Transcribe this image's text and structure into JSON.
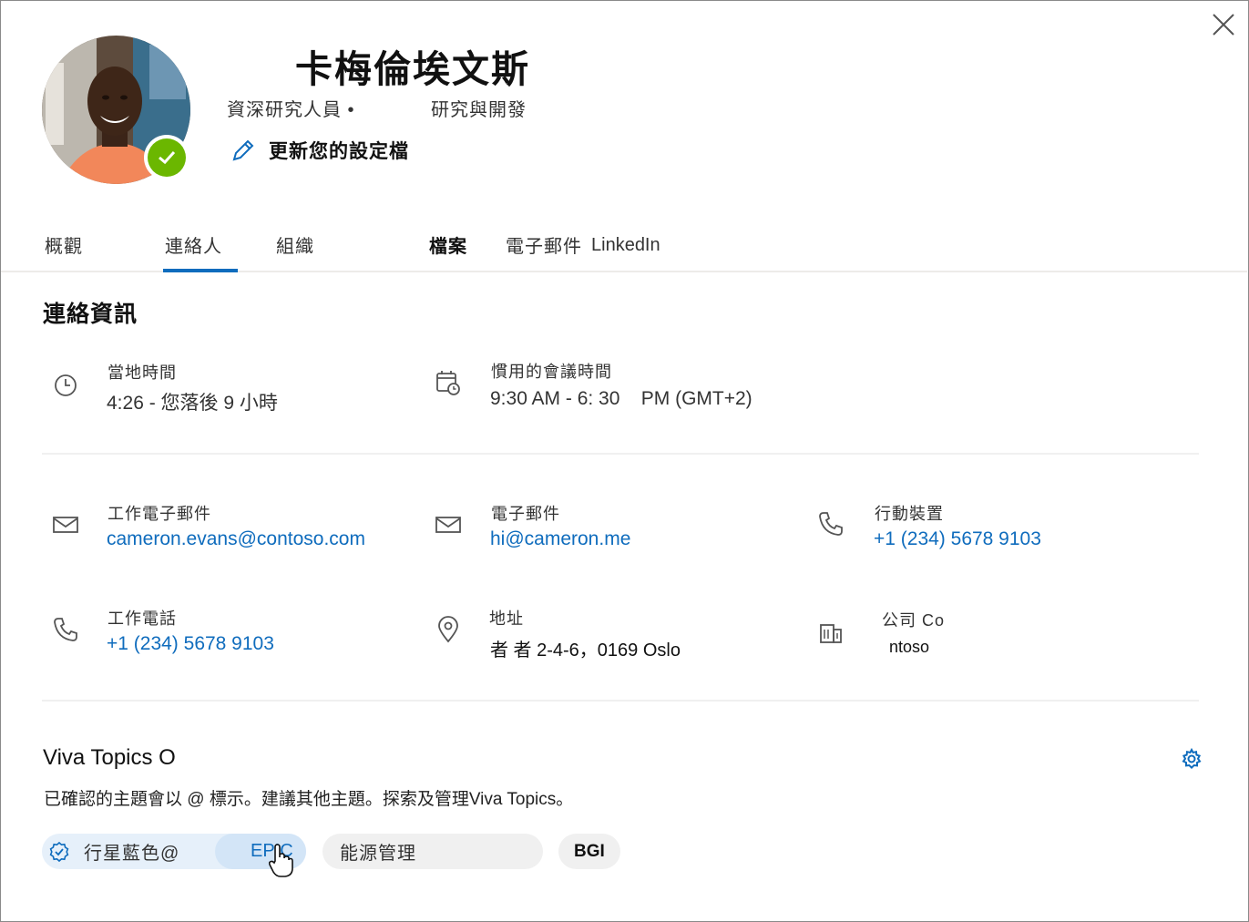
{
  "profile": {
    "name": "卡梅倫埃文斯",
    "title": "資深研究人員 •",
    "department": "研究與開發",
    "edit_label": "更新您的設定檔"
  },
  "tabs": [
    {
      "label": "概觀"
    },
    {
      "label": "連絡人"
    },
    {
      "label": "組織"
    },
    {
      "label": "檔案"
    },
    {
      "label": "電子郵件"
    },
    {
      "label": "LinkedIn"
    }
  ],
  "contact": {
    "title": "連絡資訊",
    "local_time_label": "當地時間",
    "local_time_value": "4:26 - 您落後 9 小時",
    "meeting_label": "慣用的會議時間",
    "meeting_value": "9:30 AM - 6: 30    PM (GMT+2)",
    "work_email_label": "工作電子郵件",
    "work_email": "cameron.evans@contoso.com",
    "email_label": "電子郵件",
    "email": "hi@cameron.me",
    "mobile_label": "行動裝置",
    "mobile": "+1 (234) 5678 9103",
    "work_phone_label": "工作電話",
    "work_phone": "+1 (234) 5678 9103",
    "address_label": "地址",
    "address": "者 者 2-4-6，0169 Oslo",
    "company_label": "公司 Co",
    "company": "ntoso"
  },
  "viva": {
    "title": "Viva Topics O",
    "description": "已確認的主題會以 @ 標示。建議其他主題。探索及管理Viva Topics。",
    "pills": [
      {
        "label": "行星藍色@"
      },
      {
        "label": "EPIC"
      },
      {
        "label": "能源管理"
      },
      {
        "label": "BGI"
      }
    ]
  },
  "colors": {
    "accent": "#0f6cbd",
    "presence": "#6bb700",
    "pill_confirmed": "#e6f0fa",
    "pill_hover": "#d3e5f7",
    "pill_default": "#f0f0f0"
  }
}
